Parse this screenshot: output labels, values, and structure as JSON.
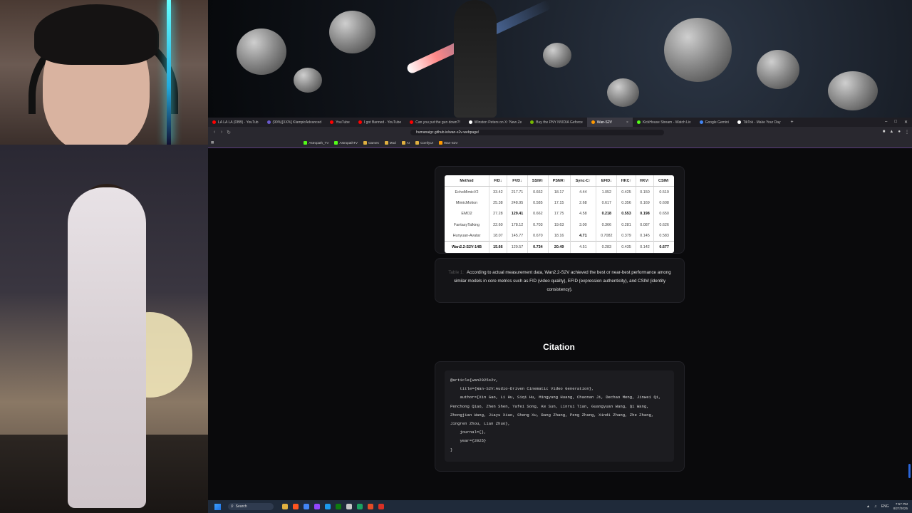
{
  "browser": {
    "tabs": [
      {
        "label": "LA LA LA (DBB) - YouTub",
        "color": "#ff0000"
      },
      {
        "label": "(90%)[XX%] KlampicAdvanced",
        "color": "#6a5acd"
      },
      {
        "label": "YouTube",
        "color": "#ff0000"
      },
      {
        "label": "I got Banned - YouTube",
        "color": "#ff0000"
      },
      {
        "label": "Can you put the gun down?!",
        "color": "#ff0000"
      },
      {
        "label": "Winston Peters on X: 'New Ze",
        "color": "#ffffff"
      },
      {
        "label": "Buy the PNY NVIDIA Geforce",
        "color": "#76b900"
      },
      {
        "label": "Wan-S2V",
        "color": "#ff9900"
      },
      {
        "label": "KickHouse Stream - Watch Liv",
        "color": "#53fc18"
      },
      {
        "label": "Google Gemini",
        "color": "#4285f4"
      },
      {
        "label": "TikTok - Make Your Day",
        "color": "#ffffff"
      }
    ],
    "new_tab": "+",
    "url": "humanaigc.github.io/wan-s2v-webpage/",
    "bookmarks": [
      {
        "label": "Astropath_TV",
        "color": "#53fc18"
      },
      {
        "label": "AstropathTV",
        "color": "#53fc18"
      },
      {
        "label": "Games",
        "color": "#e0b040"
      },
      {
        "label": "Mod",
        "color": "#e0b040"
      },
      {
        "label": "AI",
        "color": "#e0b040"
      },
      {
        "label": "ComfyUI",
        "color": "#e0b040"
      },
      {
        "label": "Wan-S2V",
        "color": "#ff9900"
      }
    ]
  },
  "table": {
    "headers": [
      "Method",
      "FID↓",
      "FVD↓",
      "SSIM↑",
      "PSNR↑",
      "Sync-C↑",
      "EFID↓",
      "HKC↑",
      "HKV↑",
      "CSIM↑"
    ],
    "rows": [
      [
        "EchoMimicV2",
        "33.42",
        "217.71",
        "0.662",
        "18.17",
        "4.44",
        "1.052",
        "0.425",
        "0.150",
        "0.519"
      ],
      [
        "MimicMotion",
        "25.38",
        "248.95",
        "0.585",
        "17.15",
        "2.68",
        "0.617",
        "0.356",
        "0.169",
        "0.608"
      ],
      [
        "EMO2",
        "27.28",
        "129.41",
        "0.662",
        "17.75",
        "4.58",
        "0.218",
        "0.553",
        "0.198",
        "0.650"
      ],
      [
        "FantasyTalking",
        "22.60",
        "178.12",
        "0.703",
        "19.63",
        "3.00",
        "0.366",
        "0.281",
        "0.087",
        "0.626"
      ],
      [
        "Hunyuan-Avatar",
        "18.07",
        "145.77",
        "0.670",
        "18.16",
        "4.71",
        "0.7082",
        "0.379",
        "0.145",
        "0.583"
      ],
      [
        "Wan2.2-S2V-14B",
        "15.66",
        "129.57",
        "0.734",
        "20.49",
        "4.51",
        "0.283",
        "0.435",
        "0.142",
        "0.677"
      ]
    ]
  },
  "description": {
    "prefix": "Table 1:",
    "text": "According to actual measurement data, Wan2.2-S2V achieved the best or near-best performance among similar models in core metrics such as FID (video quality), EFID (expression authenticity), and CSIM (identity consistency)."
  },
  "citation": {
    "heading": "Citation",
    "bibtex": "@article{wan2025s2v,\n    title={Wan-S2V:Audio-Driven Cinematic Video Generation},\n    author={Xin Gao, Li Hu, Siqi Hu, Mingyang Huang, Chaonan Ji, Dechao Meng, Jinwei Qi, Penchong Qiao, Zhen Shen, Yafei Song, Ke Sun, Linrui Tian, Guangyuan Wang, Qi Wang, Zhongjian Wang, Jiayu Xiao, Sheng Xu, Bang Zhang, Peng Zhang, Xindi Zhang, Zhe Zhang, Jingren Zhou, Lian Zhuo},\n    journal={},\n    year={2025}\n}"
  },
  "taskbar": {
    "search": "Search",
    "lang": "ENG",
    "time": "7:57 PM",
    "date": "8/27/2025"
  }
}
